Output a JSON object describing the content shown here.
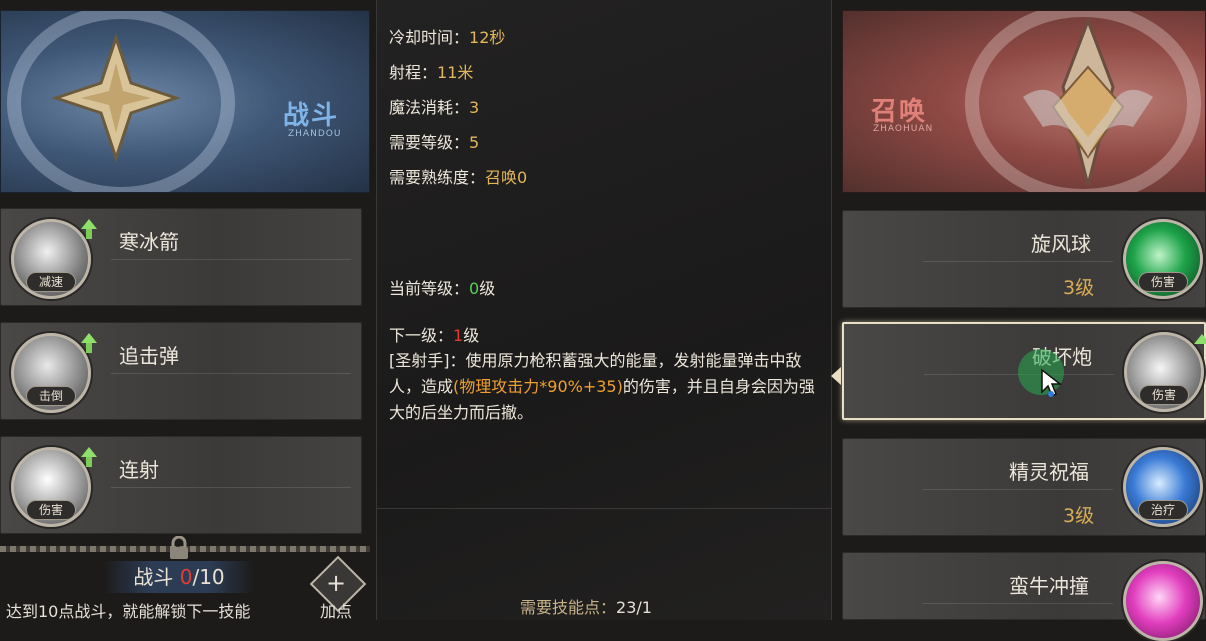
{
  "left_class": {
    "name": "战斗",
    "subtitle": "ZHANDOU"
  },
  "right_class": {
    "name": "召唤",
    "subtitle": "ZHAOHUAN"
  },
  "left_skills": [
    {
      "name": "寒冰箭",
      "tag": "减速"
    },
    {
      "name": "追击弹",
      "tag": "击倒"
    },
    {
      "name": "连射",
      "tag": "伤害"
    }
  ],
  "right_skills": [
    {
      "name": "旋风球",
      "level": "3级",
      "tag": "伤害"
    },
    {
      "name": "破坏炮",
      "level": "",
      "tag": "伤害"
    },
    {
      "name": "精灵祝福",
      "level": "3级",
      "tag": "治疗"
    },
    {
      "name": "蛮牛冲撞",
      "level": "",
      "tag": ""
    }
  ],
  "details": {
    "cooldown_label": "冷却时间：",
    "cooldown_value": "12秒",
    "range_label": "射程：",
    "range_value": "11米",
    "mana_label": "魔法消耗：",
    "mana_value": "3",
    "req_level_label": "需要等级：",
    "req_level_value": "5",
    "proficiency_label": "需要熟练度：",
    "proficiency_value": "召唤0",
    "current_level_label": "当前等级：",
    "current_level_num": "0",
    "current_level_unit": "级",
    "next_level_label": "下一级：",
    "next_level_num": "1",
    "next_level_unit": "级",
    "desc_part1": "[圣射手]：使用原力枪积蓄强大的能量，发射能量弹击中敌人，造成",
    "desc_highlight": "(物理攻击力*90%+35)",
    "desc_part2": "的伤害，并且自身会因为强大的后坐力而后撤。",
    "skill_points_label": "需要技能点：",
    "skill_points_value": "23/1"
  },
  "progress": {
    "label": "战斗 ",
    "current": "0",
    "max": "/10"
  },
  "unlock_hint": "达到10点战斗，就能解锁下一技能",
  "add_button_label": "加点"
}
